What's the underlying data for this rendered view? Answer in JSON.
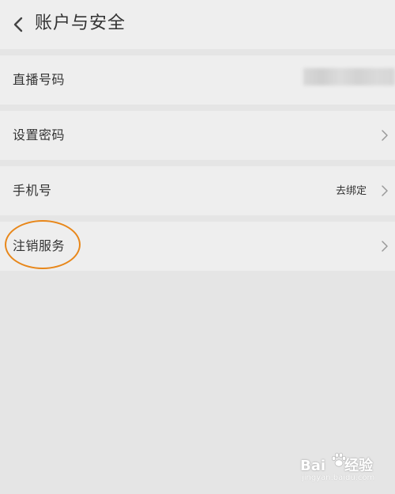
{
  "header": {
    "title": "账户与安全",
    "back_icon": "chevron-left-icon"
  },
  "rows": [
    {
      "label": "直播号码",
      "value": ""
    },
    {
      "label": "设置密码",
      "value": ""
    },
    {
      "label": "手机号",
      "value": "去绑定"
    },
    {
      "label": "注销服务",
      "value": ""
    }
  ],
  "watermark": {
    "main_a": "Bai",
    "main_b": "经验",
    "sub": "jingyan.baidu.com"
  },
  "colors": {
    "background": "#e5e5e5",
    "row_background": "#eeeeee",
    "text": "#333333",
    "annotation": "#e8871a",
    "chevron": "#999999"
  }
}
